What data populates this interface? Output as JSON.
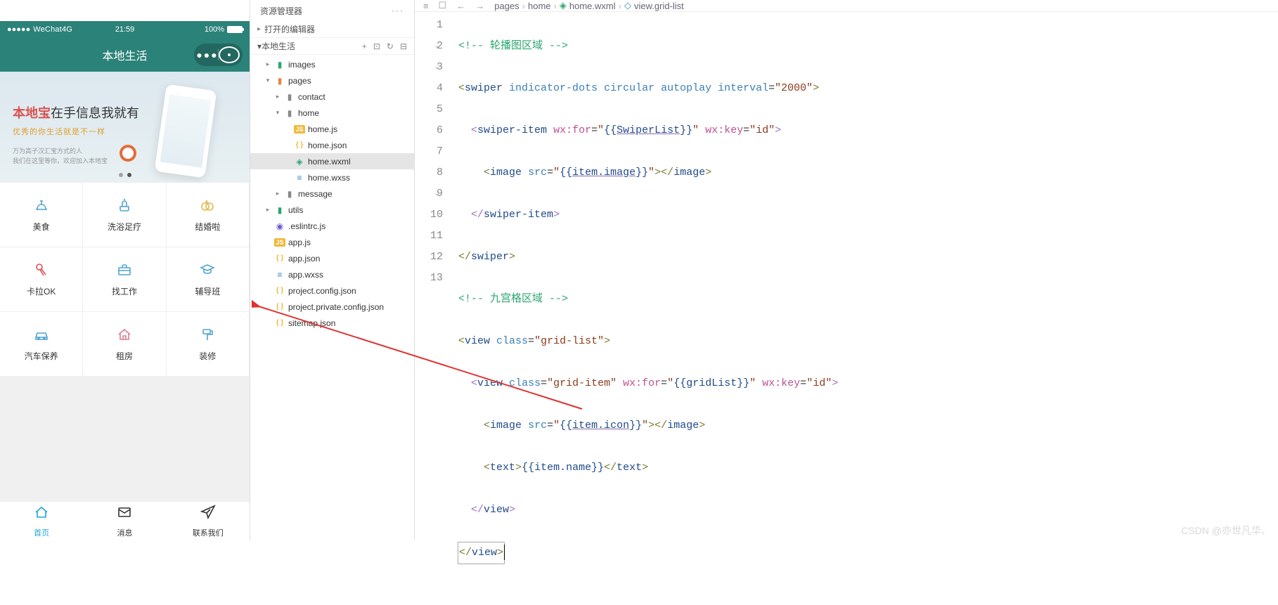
{
  "simulator": {
    "status": {
      "carrier": "WeChat4G",
      "signal_dots": "●●●●●",
      "time": "21:59",
      "battery": "100%"
    },
    "nav": {
      "title": "本地生活",
      "menu_dots": "●●●"
    },
    "banner": {
      "title_brand": "本地宝",
      "title_rest": "在手信息我就有",
      "subtitle": "优秀的你生活就是不一样",
      "small1": "万为高子汉汇宝方式的人",
      "small2": "我们在这里等你，欢迎加入本地宝",
      "active_dot": 1,
      "total_dots": 2
    },
    "grid": [
      {
        "label": "美食",
        "icon": "food-icon",
        "color": "#4fa3d1"
      },
      {
        "label": "洗浴足疗",
        "icon": "spa-icon",
        "color": "#4fa3d1"
      },
      {
        "label": "结婚啦",
        "icon": "rings-icon",
        "color": "#e4b850"
      },
      {
        "label": "卡拉OK",
        "icon": "mic-icon",
        "color": "#d9534f"
      },
      {
        "label": "找工作",
        "icon": "briefcase-icon",
        "color": "#4fa3d1"
      },
      {
        "label": "辅导班",
        "icon": "graduate-icon",
        "color": "#4fa3d1"
      },
      {
        "label": "汽车保养",
        "icon": "car-icon",
        "color": "#4fa3d1"
      },
      {
        "label": "租房",
        "icon": "house-icon",
        "color": "#d98090"
      },
      {
        "label": "装修",
        "icon": "paint-icon",
        "color": "#4fa3d1"
      }
    ],
    "tabs": [
      {
        "label": "首页",
        "icon": "home-icon",
        "active": true
      },
      {
        "label": "消息",
        "icon": "message-icon",
        "active": false
      },
      {
        "label": "联系我们",
        "icon": "contact-icon",
        "active": false
      }
    ]
  },
  "explorer": {
    "title": "资源管理器",
    "section_editors": "打开的编辑器",
    "project_name": "本地生活",
    "head_icons": [
      "+",
      "⊡",
      "↻",
      "⊟"
    ],
    "tree": [
      {
        "depth": 1,
        "chev": "▸",
        "icon": "📁",
        "iconClass": "ic-images",
        "name": "images"
      },
      {
        "depth": 1,
        "chev": "▾",
        "icon": "📁",
        "iconClass": "ic-pages",
        "name": "pages"
      },
      {
        "depth": 2,
        "chev": "▸",
        "icon": "📁",
        "iconClass": "ic-folder",
        "name": "contact"
      },
      {
        "depth": 2,
        "chev": "▾",
        "icon": "📁",
        "iconClass": "ic-folder",
        "name": "home"
      },
      {
        "depth": 3,
        "chev": "",
        "icon": "JS",
        "iconClass": "ic-js",
        "name": "home.js"
      },
      {
        "depth": 3,
        "chev": "",
        "icon": "{ }",
        "iconClass": "ic-json",
        "name": "home.json"
      },
      {
        "depth": 3,
        "chev": "",
        "icon": "◈",
        "iconClass": "ic-wxml",
        "name": "home.wxml",
        "selected": true
      },
      {
        "depth": 3,
        "chev": "",
        "icon": "≡",
        "iconClass": "ic-wxss",
        "name": "home.wxss"
      },
      {
        "depth": 2,
        "chev": "▸",
        "icon": "📁",
        "iconClass": "ic-folder",
        "name": "message"
      },
      {
        "depth": 1,
        "chev": "▸",
        "icon": "📁",
        "iconClass": "ic-utils",
        "name": "utils"
      },
      {
        "depth": 1,
        "chev": "",
        "icon": "◉",
        "iconClass": "ic-eslint",
        "name": ".eslintrc.js"
      },
      {
        "depth": 1,
        "chev": "",
        "icon": "JS",
        "iconClass": "ic-js",
        "name": "app.js"
      },
      {
        "depth": 1,
        "chev": "",
        "icon": "{ }",
        "iconClass": "ic-json",
        "name": "app.json"
      },
      {
        "depth": 1,
        "chev": "",
        "icon": "≡",
        "iconClass": "ic-wxss",
        "name": "app.wxss"
      },
      {
        "depth": 1,
        "chev": "",
        "icon": "{ }",
        "iconClass": "ic-json",
        "name": "project.config.json"
      },
      {
        "depth": 1,
        "chev": "",
        "icon": "{ }",
        "iconClass": "ic-json",
        "name": "project.private.config.json"
      },
      {
        "depth": 1,
        "chev": "",
        "icon": "{ }",
        "iconClass": "ic-json",
        "name": "sitemap.json"
      }
    ]
  },
  "editor": {
    "breadcrumb": {
      "p1": "pages",
      "p2": "home",
      "p3": "home.wxml",
      "p4": "view.grid-list"
    },
    "code": {
      "l1": {
        "comment": "轮播图区域"
      },
      "l2": {
        "tag": "swiper",
        "attrs": "indicator-dots circular autoplay",
        "attr_k": "interval",
        "attr_v": "2000"
      },
      "l3": {
        "tag": "swiper-item",
        "a1k": "wx:for",
        "a1v": "{{SwiperList}}",
        "a2k": "wx:key",
        "a2v": "id"
      },
      "l4": {
        "tag": "image",
        "ak": "src",
        "av": "{{item.image}}",
        "close": "image"
      },
      "l5": {
        "close": "swiper-item"
      },
      "l6": {
        "close": "swiper"
      },
      "l7": {
        "comment": "九宫格区域"
      },
      "l8": {
        "tag": "view",
        "ak": "class",
        "av": "grid-list"
      },
      "l9": {
        "tag": "view",
        "a1k": "class",
        "a1v": "grid-item",
        "a2k": "wx:for",
        "a2v": "{{gridList}}",
        "a3k": "wx:key",
        "a3v": "id"
      },
      "l10": {
        "tag": "image",
        "ak": "src",
        "av": "{{item.icon}}",
        "close": "image"
      },
      "l11": {
        "tag": "text",
        "inner": "{{item.name}}",
        "close": "text"
      },
      "l12": {
        "close": "view"
      },
      "l13": {
        "close": "view"
      }
    }
  },
  "watermark": "CSDN @亦世凡华、"
}
